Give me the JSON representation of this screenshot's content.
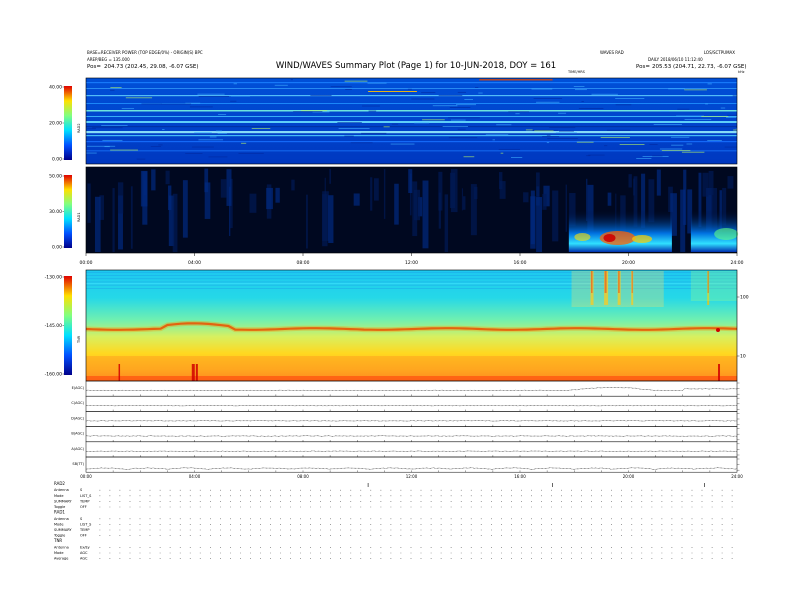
{
  "header": {
    "title": "WIND/WAVES Summary Plot (Page 1) for 10-JUN-2018, DOY = 161",
    "left_line1": "BASE=RECEIVER POWER (TOP EDGE/0%) - ORIGIN(S) BPC",
    "left_line2": "AREP/BEG = 135.000",
    "left_pos_label": "Pos=",
    "left_pos_value": "204.73 (202.45, 29.08, -6.07 GSE)",
    "right_top1": "WAVES RAD",
    "right_top2": "LOS/SCTPUMAX",
    "right_line2": "DAILY 2018/06/10 11:12:40",
    "right_pos_label": "Pos=",
    "right_pos_value": "205.53 (204.71, 22.73, -6.07 GSE)",
    "hours_label": "TIME/HRS",
    "khz_label": "kHz"
  },
  "legend": {
    "rad2": "RAD2",
    "rad1": "RAD1",
    "tnr": "TNR"
  },
  "status_block": {
    "rad2_title": "RAD2",
    "rad1_title": "RAD1",
    "tnr_title": "TNR",
    "rows": [
      [
        "Antenna",
        "S"
      ],
      [
        "Mode",
        "LIST_S"
      ],
      [
        "SUMMARY",
        "TEMP"
      ],
      [
        "Toggle",
        "OFF"
      ],
      [
        "Antenna",
        "S"
      ],
      [
        "Mode",
        "LIST_S"
      ],
      [
        "SUMMARY",
        "TEMP"
      ],
      [
        "Toggle",
        "OFF"
      ],
      [
        "Antenna",
        "Ex/Ey"
      ],
      [
        "Mode",
        "AGC"
      ],
      [
        "Average",
        "AGC"
      ]
    ]
  },
  "chart_data": [
    {
      "type": "heatmap",
      "name": "RAD2",
      "colorbar_ticks": [
        "40.00",
        "20.00",
        "0.00"
      ],
      "x_range": [
        0,
        24
      ],
      "note": "Dynamic spectrum, mostly quiet background with narrow horizontal bands"
    },
    {
      "type": "heatmap",
      "name": "RAD1",
      "colorbar_ticks": [
        "50.00",
        "30.00",
        "0.00"
      ],
      "xticks": [
        "00:00",
        "04:00",
        "08:00",
        "12:00",
        "16:00",
        "20:00",
        "24:00"
      ],
      "x_range": [
        0,
        24
      ],
      "bursts": [
        {
          "start": 17.8,
          "end": 21.6
        },
        {
          "start": 22.3,
          "end": 24
        }
      ]
    },
    {
      "type": "heatmap",
      "name": "TNR",
      "colorbar_ticks": [
        "-130.00",
        "-145.00",
        "-160.00"
      ],
      "right_axis_ticks": [
        "100",
        "10"
      ],
      "x_range": [
        0,
        24
      ]
    },
    {
      "type": "line",
      "name": "Antenna/AGC traces",
      "panels": [
        "E(AGC)",
        "C(AGC)",
        "D(AGC)",
        "B(AGC)",
        "A(AGC)",
        "SB(TT)"
      ],
      "xticks": [
        "00:00",
        "04:00",
        "08:00",
        "12:00",
        "16:00",
        "20:00",
        "24:00"
      ],
      "x_range": [
        0,
        24
      ]
    }
  ]
}
